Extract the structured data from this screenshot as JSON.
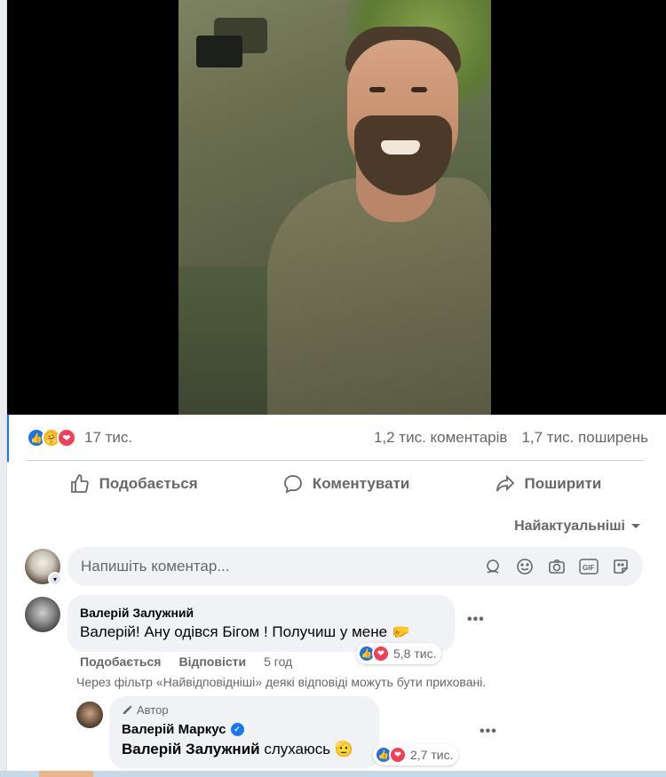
{
  "post": {
    "reaction_count": "17 тис.",
    "comments_count": "1,2 тис. коментарів",
    "shares_count": "1,7 тис. поширень"
  },
  "actions": {
    "like": "Подобається",
    "comment": "Коментувати",
    "share": "Поширити"
  },
  "sort": {
    "label": "Найактуальніші"
  },
  "composer": {
    "placeholder": "Напишіть коментар..."
  },
  "comments": [
    {
      "author": "Валерій Залужний",
      "text": "Валерій! Ану одівся Бігом ! Получиш у мене 🤛",
      "reaction_count": "5,8 тис.",
      "like_action": "Подобається",
      "reply_action": "Відповісти",
      "time": "5 год"
    }
  ],
  "filter_note": "Через фільтр «Найвідповідніші» деякі відповіді можуть бути приховані.",
  "reply": {
    "author_tag": "Автор",
    "author": "Валерій Маркус",
    "mention": "Валерій Залужний",
    "text": " слухаюсь 🫡",
    "reaction_count": "2,7 тис."
  },
  "colors": {
    "like_blue": "#1b74e4",
    "love_red": "#f33e58",
    "care_yellow": "#f7b928",
    "text_secondary": "#65676b"
  }
}
